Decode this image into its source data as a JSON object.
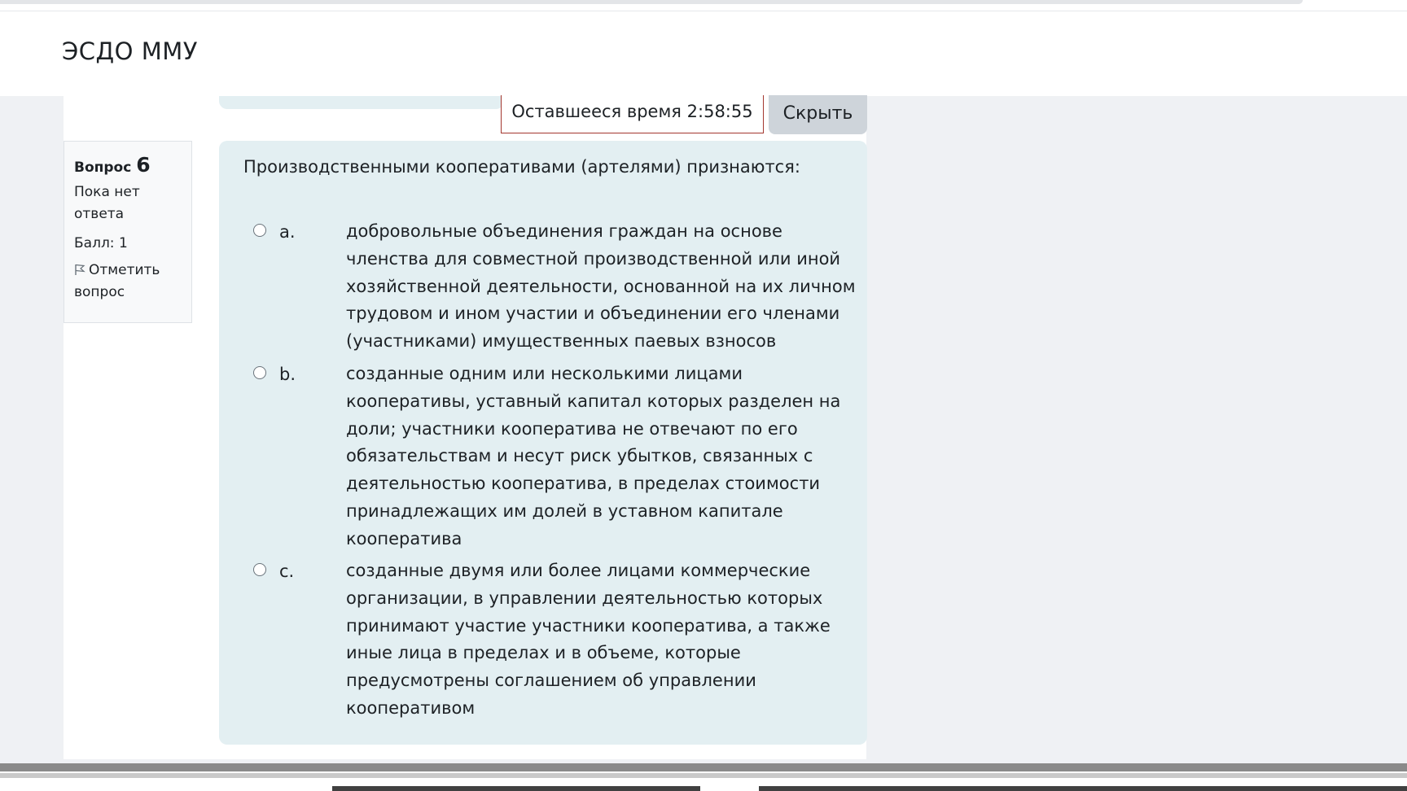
{
  "navbar": {
    "brand": "ЭСДО ММУ"
  },
  "timer": {
    "label": "Оставшееся время",
    "value": "2:58:55"
  },
  "hide_button": "Скрыть",
  "question_info": {
    "label": "Вопрос",
    "number": "6",
    "state": "Пока нет ответа",
    "grade": "Балл: 1",
    "flag": "Отметить вопрос"
  },
  "question": {
    "text": "Производственными кооперативами (артелями) признаются:",
    "answers": [
      {
        "letter": "a.",
        "text": "добровольные объединения граждан на основе членства для совместной производственной или иной хозяйственной деятельности, основанной на их личном трудовом и ином участии и объединении его членами (участниками) имущественных паевых взносов"
      },
      {
        "letter": "b.",
        "text": "созданные одним или несколькими лицами кооперативы, уставный капитал которых разделен на доли; участники кооператива не отвечают по его обязательствам и несут риск убытков, связанных с деятельностью кооператива, в пределах стоимости принадлежащих им долей в уставном капитале кооператива"
      },
      {
        "letter": "c.",
        "text": "созданные двумя или более лицами коммерческие организации, в управлении деятельностью которых принимают участие участники кооператива, а также иные лица в пределах и в объеме, которые предусмотрены соглашением об управлении кооперативом"
      }
    ]
  }
}
